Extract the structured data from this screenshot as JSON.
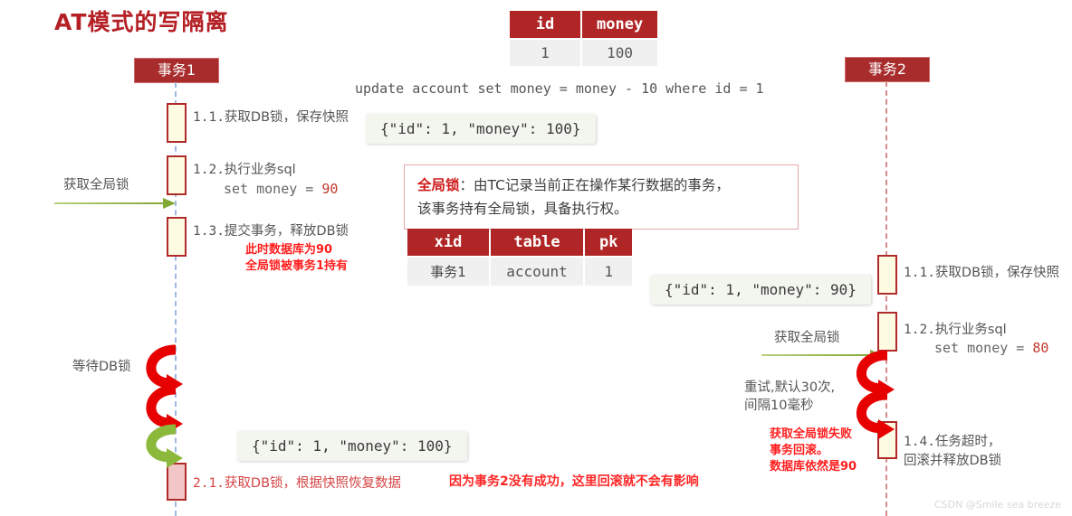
{
  "title": "AT模式的写隔离",
  "watermark": "CSDN @Smile sea breeze",
  "colors": {
    "brand_red": "#b02626",
    "dark_red": "#a82c2c",
    "alert_red": "#ff1e1e",
    "green_arrow": "#8cb83c",
    "loop_red": "#e60000",
    "lifeline_blue": "#9fb8dd",
    "activation_fill": "#fdfce3",
    "activation_pink": "#f2c6c6"
  },
  "sql": {
    "statement": "update account set money = money - 10 where id = 1"
  },
  "account_table": {
    "headers": [
      "id",
      "money"
    ],
    "rows": [
      [
        "1",
        "100"
      ]
    ]
  },
  "lock_table": {
    "headers": [
      "xid",
      "table",
      "pk"
    ],
    "rows": [
      [
        "事务1",
        "account",
        "1"
      ]
    ]
  },
  "global_lock_note": {
    "term": "全局锁",
    "line1": "：由TC记录当前正在操作某行数据的事务，",
    "line2": "该事务持有全局锁，具备执行权。"
  },
  "tx1": {
    "actor_label": "事务1",
    "acquire_global_lock_label": "获取全局锁",
    "wait_db_lock_label": "等待DB锁",
    "steps": [
      {
        "num": "1.1.",
        "text": "获取DB锁，保存快照"
      },
      {
        "num": "1.2.",
        "text": "执行业务sql",
        "sub_prefix": "set money = ",
        "sub_value": "90"
      },
      {
        "num": "1.3.",
        "text": "提交事务，释放DB锁"
      }
    ],
    "step13_notes": [
      "此时数据库为90",
      "全局锁被事务1持有"
    ],
    "snapshot_json_top": "{\"id\": 1, \"money\": 100}",
    "snapshot_json_bottom": "{\"id\": 1, \"money\": 100}",
    "step21": {
      "num": "2.1.",
      "text": "获取DB锁，根据快照恢复数据"
    },
    "bottom_note": "因为事务2没有成功，这里回滚就不会有影响"
  },
  "tx2": {
    "actor_label": "事务2",
    "acquire_global_lock_label": "获取全局锁",
    "snapshot_json": "{\"id\": 1, \"money\": 90}",
    "steps": [
      {
        "num": "1.1.",
        "text": "获取DB锁，保存快照"
      },
      {
        "num": "1.2.",
        "text": "执行业务sql",
        "sub_prefix": "set money = ",
        "sub_value": "80"
      },
      {
        "num": "1.4.",
        "text": "任务超时，",
        "text2": "回滚并释放DB锁"
      }
    ],
    "retry_note": [
      "重试,默认30次,",
      "间隔10毫秒"
    ],
    "fail_notes": [
      "获取全局锁失败",
      "事务回滚。",
      "数据库依然是90"
    ]
  }
}
